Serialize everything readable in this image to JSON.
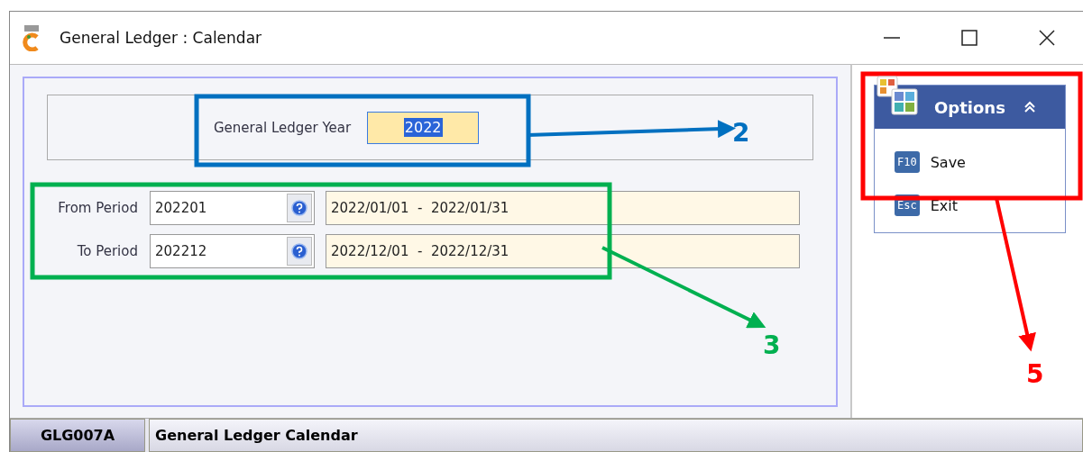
{
  "window": {
    "title": "General Ledger : Calendar"
  },
  "year": {
    "label": "General Ledger Year",
    "value": "2022",
    "selected": true
  },
  "periods": [
    {
      "label": "From Period",
      "value": "202201",
      "range": "2022/01/01  -  2022/01/31"
    },
    {
      "label": "To Period",
      "value": "202212",
      "range": "2022/12/01  -  2022/12/31"
    }
  ],
  "options": {
    "title": "Options",
    "expanded": true,
    "items": [
      {
        "key": "F10",
        "label": "Save"
      },
      {
        "key": "Esc",
        "label": "Exit"
      }
    ]
  },
  "status_bar": {
    "code": "GLG007A",
    "text": "General Ledger Calendar"
  },
  "annotations": [
    {
      "label": "2",
      "color": "#0070c0"
    },
    {
      "label": "3",
      "color": "#00b050"
    },
    {
      "label": "5",
      "color": "#ff0000"
    }
  ]
}
